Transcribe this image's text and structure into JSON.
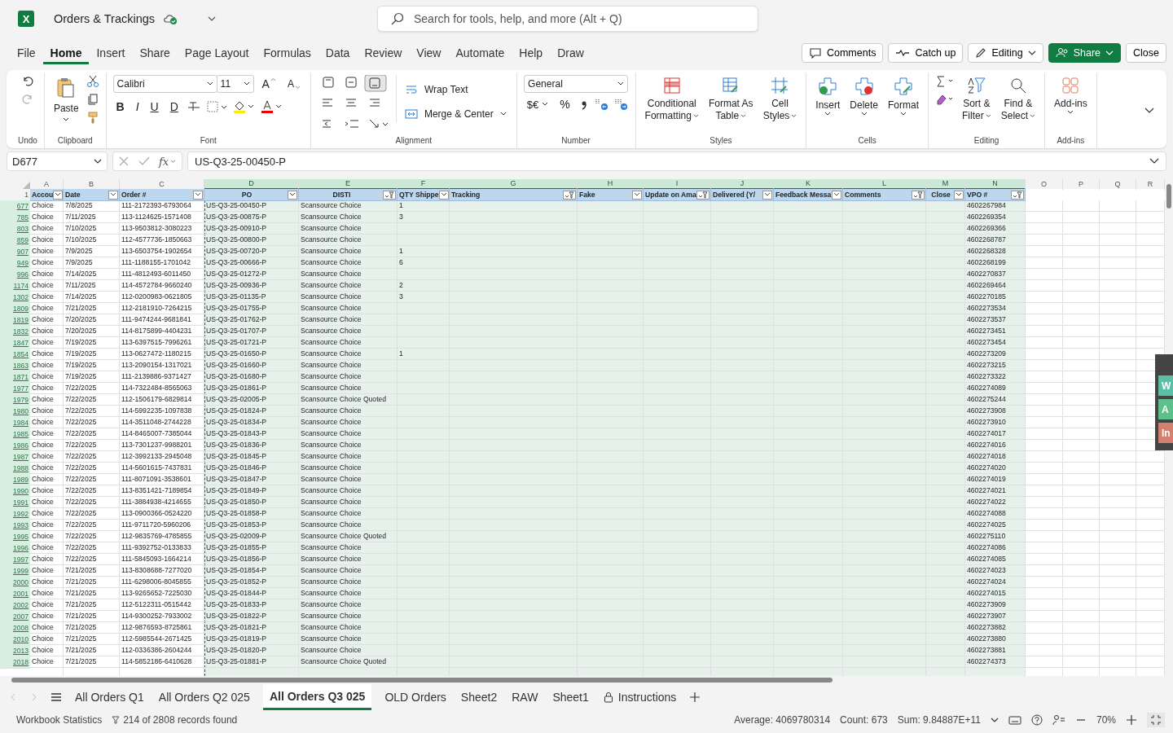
{
  "app": {
    "logo": "X",
    "title": "Orders & Trackings"
  },
  "search": {
    "placeholder": "Search for tools, help, and more (Alt + Q)"
  },
  "menu": [
    {
      "label": "File",
      "selected": false
    },
    {
      "label": "Home",
      "selected": true
    },
    {
      "label": "Insert",
      "selected": false
    },
    {
      "label": "Share",
      "selected": false
    },
    {
      "label": "Page Layout",
      "selected": false
    },
    {
      "label": "Formulas",
      "selected": false
    },
    {
      "label": "Data",
      "selected": false
    },
    {
      "label": "Review",
      "selected": false
    },
    {
      "label": "View",
      "selected": false
    },
    {
      "label": "Automate",
      "selected": false
    },
    {
      "label": "Help",
      "selected": false
    },
    {
      "label": "Draw",
      "selected": false
    }
  ],
  "actions": [
    {
      "label": "Comments",
      "kind": "comments"
    },
    {
      "label": "Catch up",
      "kind": "catchup"
    },
    {
      "label": "Editing",
      "kind": "editing"
    },
    {
      "label": "Share",
      "kind": "share"
    },
    {
      "label": "Close",
      "kind": "close"
    }
  ],
  "ribbon": {
    "undo": "Undo",
    "paste": "Paste",
    "clipboard": "Clipboard",
    "font_name": "Calibri",
    "font_size": "11",
    "grow": "A",
    "shrink": "A",
    "styles_letters": [
      "B",
      "I",
      "U",
      "D"
    ],
    "font": "Font",
    "wrap": "Wrap Text",
    "merge": "Merge & Center",
    "alignment": "Alignment",
    "number_format": "General",
    "currency": "$€",
    "percent": "%",
    "number": "Number",
    "styles": [
      [
        "Conditional",
        "Formatting"
      ],
      [
        "Format As",
        "Table"
      ],
      [
        "Cell",
        "Styles"
      ]
    ],
    "styles_group": "Styles",
    "cells": [
      "Insert",
      "Delete",
      "Format"
    ],
    "cells_group": "Cells",
    "editing": [
      [
        "Sort &",
        "Filter"
      ],
      [
        "Find &",
        "Select"
      ]
    ],
    "editing_group": "Editing",
    "addins": "Add-ins",
    "addins_group": "Add-ins"
  },
  "formula_bar": {
    "name_box": "D677",
    "fx": "fx",
    "value": "US-Q3-25-00450-P"
  },
  "columns": [
    {
      "letter": "A",
      "header": "Accou",
      "filtered": false,
      "selected": false
    },
    {
      "letter": "B",
      "header": "Date",
      "filtered": false,
      "selected": false
    },
    {
      "letter": "C",
      "header": "Order #",
      "filtered": false,
      "selected": false
    },
    {
      "letter": "D",
      "header": "PO",
      "filtered": false,
      "selected": true
    },
    {
      "letter": "E",
      "header": "DISTI",
      "filtered": true,
      "selected": true
    },
    {
      "letter": "F",
      "header": "QTY Shippe",
      "filtered": false,
      "selected": true
    },
    {
      "letter": "G",
      "header": "Tracking",
      "filtered": true,
      "selected": true
    },
    {
      "letter": "H",
      "header": "Fake",
      "filtered": false,
      "selected": true
    },
    {
      "letter": "I",
      "header": "Update on Ama",
      "filtered": true,
      "selected": true
    },
    {
      "letter": "J",
      "header": "Delivered (Y/",
      "filtered": false,
      "selected": true
    },
    {
      "letter": "K",
      "header": "Feedback Messa",
      "filtered": false,
      "selected": true
    },
    {
      "letter": "L",
      "header": "Comments",
      "filtered": true,
      "selected": true
    },
    {
      "letter": "M",
      "header": "Close",
      "filtered": false,
      "selected": true
    },
    {
      "letter": "N",
      "header": "VPO #",
      "filtered": true,
      "selected": true
    },
    {
      "letter": "O",
      "selected": false
    },
    {
      "letter": "P",
      "selected": false
    },
    {
      "letter": "Q",
      "selected": false
    },
    {
      "letter": "R",
      "selected": false
    }
  ],
  "header_row": "1",
  "rows": [
    {
      "row": "677",
      "A": "Choice",
      "B": "7/8/2025",
      "C": "111-2172393-6793064",
      "D": "US-Q3-25-00450-P",
      "E": "Scansource Choice",
      "F": "1",
      "N": "4602267984"
    },
    {
      "row": "785",
      "A": "Choice",
      "B": "7/11/2025",
      "C": "113-1124625-1571408",
      "D": "US-Q3-25-00875-P",
      "E": "Scansource Choice",
      "F": "3",
      "N": "4602269354"
    },
    {
      "row": "803",
      "A": "Choice",
      "B": "7/10/2025",
      "C": "113-9503812-3080223",
      "D": "US-Q3-25-00910-P",
      "E": "Scansource Choice",
      "N": "4602269366"
    },
    {
      "row": "859",
      "A": "Choice",
      "B": "7/10/2025",
      "C": "112-4577736-1850663",
      "D": "US-Q3-25-00800-P",
      "E": "Scansource Choice",
      "N": "4602268787"
    },
    {
      "row": "907",
      "A": "Choice",
      "B": "7/9/2025",
      "C": "113-6503754-1902654",
      "D": "US-Q3-25-00720-P",
      "E": "Scansource Choice",
      "F": "1",
      "N": "4602268328"
    },
    {
      "row": "949",
      "A": "Choice",
      "B": "7/9/2025",
      "C": "111-1188155-1701042",
      "D": "US-Q3-25-00666-P",
      "E": "Scansource Choice",
      "F": "6",
      "N": "4602268199"
    },
    {
      "row": "996",
      "A": "Choice",
      "B": "7/14/2025",
      "C": "111-4812493-6011450",
      "D": "US-Q3-25-01272-P",
      "E": "Scansource Choice",
      "N": "4602270837"
    },
    {
      "row": "1174",
      "A": "Choice",
      "B": "7/11/2025",
      "C": "114-4572784-9660240",
      "D": "US-Q3-25-00936-P",
      "E": "Scansource Choice",
      "F": "2",
      "N": "4602269464"
    },
    {
      "row": "1302",
      "A": "Choice",
      "B": "7/14/2025",
      "C": "112-0200983-0621805",
      "D": "US-Q3-25-01135-P",
      "E": "Scansource Choice",
      "F": "3",
      "N": "4602270185"
    },
    {
      "row": "1809",
      "A": "Choice",
      "B": "7/21/2025",
      "C": "112-2181910-7264215",
      "D": "US-Q3-25-01755-P",
      "E": "Scansource Choice",
      "N": "4602273534"
    },
    {
      "row": "1819",
      "A": "Choice",
      "B": "7/20/2025",
      "C": "111-9474244-9681841",
      "D": "US-Q3-25-01762-P",
      "E": "Scansource Choice",
      "N": "4602273537"
    },
    {
      "row": "1832",
      "A": "Choice",
      "B": "7/20/2025",
      "C": "114-8175899-4404231",
      "D": "US-Q3-25-01707-P",
      "E": "Scansource Choice",
      "N": "4602273451"
    },
    {
      "row": "1847",
      "A": "Choice",
      "B": "7/19/2025",
      "C": "113-6397515-7996261",
      "D": "US-Q3-25-01721-P",
      "E": "Scansource Choice",
      "N": "4602273454"
    },
    {
      "row": "1854",
      "A": "Choice",
      "B": "7/19/2025",
      "C": "113-0627472-1180215",
      "D": "US-Q3-25-01650-P",
      "E": "Scansource Choice",
      "F": "1",
      "N": "4602273209"
    },
    {
      "row": "1863",
      "A": "Choice",
      "B": "7/19/2025",
      "C": "113-2090154-1317021",
      "D": "US-Q3-25-01660-P",
      "E": "Scansource Choice",
      "N": "4602273215"
    },
    {
      "row": "1871",
      "A": "Choice",
      "B": "7/19/2025",
      "C": "111-2139886-9371427",
      "D": "US-Q3-25-01680-P",
      "E": "Scansource Choice",
      "N": "4602273322"
    },
    {
      "row": "1977",
      "A": "Choice",
      "B": "7/22/2025",
      "C": "114-7322484-8565063",
      "D": "US-Q3-25-01861-P",
      "E": "Scansource Choice",
      "N": "4602274089"
    },
    {
      "row": "1979",
      "A": "Choice",
      "B": "7/22/2025",
      "C": "112-1506179-6829814",
      "D": "US-Q3-25-02005-P",
      "E": "Scansource Choice Quoted",
      "N": "4602275244"
    },
    {
      "row": "1980",
      "A": "Choice",
      "B": "7/22/2025",
      "C": "114-5992235-1097838",
      "D": "US-Q3-25-01824-P",
      "E": "Scansource Choice",
      "N": "4602273908"
    },
    {
      "row": "1984",
      "A": "Choice",
      "B": "7/22/2025",
      "C": "114-3511048-2744228",
      "D": "US-Q3-25-01834-P",
      "E": "Scansource Choice",
      "N": "4602273910"
    },
    {
      "row": "1985",
      "A": "Choice",
      "B": "7/22/2025",
      "C": "114-8465007-7385044",
      "D": "US-Q3-25-01843-P",
      "E": "Scansource Choice",
      "N": "4602274017"
    },
    {
      "row": "1986",
      "A": "Choice",
      "B": "7/22/2025",
      "C": "113-7301237-9988201",
      "D": "US-Q3-25-01836-P",
      "E": "Scansource Choice",
      "N": "4602274016"
    },
    {
      "row": "1987",
      "A": "Choice",
      "B": "7/22/2025",
      "C": "112-3992133-2945048",
      "D": "US-Q3-25-01845-P",
      "E": "Scansource Choice",
      "N": "4602274018"
    },
    {
      "row": "1988",
      "A": "Choice",
      "B": "7/22/2025",
      "C": "114-5601615-7437831",
      "D": "US-Q3-25-01846-P",
      "E": "Scansource Choice",
      "N": "4602274020"
    },
    {
      "row": "1989",
      "A": "Choice",
      "B": "7/22/2025",
      "C": "111-8071091-3538601",
      "D": "US-Q3-25-01847-P",
      "E": "Scansource Choice",
      "N": "4602274019"
    },
    {
      "row": "1990",
      "A": "Choice",
      "B": "7/22/2025",
      "C": "113-8351421-7189854",
      "D": "US-Q3-25-01849-P",
      "E": "Scansource Choice",
      "N": "4602274021"
    },
    {
      "row": "1991",
      "A": "Choice",
      "B": "7/22/2025",
      "C": "111-3884938-4214655",
      "D": "US-Q3-25-01850-P",
      "E": "Scansource Choice",
      "N": "4602274022"
    },
    {
      "row": "1992",
      "A": "Choice",
      "B": "7/22/2025",
      "C": "113-0900366-0524220",
      "D": "US-Q3-25-01858-P",
      "E": "Scansource Choice",
      "N": "4602274088"
    },
    {
      "row": "1993",
      "A": "Choice",
      "B": "7/22/2025",
      "C": "111-9711720-5960206",
      "D": "US-Q3-25-01853-P",
      "E": "Scansource Choice",
      "N": "4602274025"
    },
    {
      "row": "1995",
      "A": "Choice",
      "B": "7/22/2025",
      "C": "112-9835769-4785855",
      "D": "US-Q3-25-02009-P",
      "E": "Scansource Choice Quoted",
      "N": "4602275110"
    },
    {
      "row": "1996",
      "A": "Choice",
      "B": "7/22/2025",
      "C": "111-9392752-0133833",
      "D": "US-Q3-25-01855-P",
      "E": "Scansource Choice",
      "N": "4602274086"
    },
    {
      "row": "1997",
      "A": "Choice",
      "B": "7/22/2025",
      "C": "111-5845093-1664214",
      "D": "US-Q3-25-01856-P",
      "E": "Scansource Choice",
      "N": "4602274085"
    },
    {
      "row": "1999",
      "A": "Choice",
      "B": "7/21/2025",
      "C": "113-8308688-7277020",
      "D": "US-Q3-25-01854-P",
      "E": "Scansource Choice",
      "N": "4602274023"
    },
    {
      "row": "2000",
      "A": "Choice",
      "B": "7/21/2025",
      "C": "111-6298006-8045855",
      "D": "US-Q3-25-01852-P",
      "E": "Scansource Choice",
      "N": "4602274024"
    },
    {
      "row": "2001",
      "A": "Choice",
      "B": "7/21/2025",
      "C": "113-9265652-7225030",
      "D": "US-Q3-25-01844-P",
      "E": "Scansource Choice",
      "N": "4602274015"
    },
    {
      "row": "2002",
      "A": "Choice",
      "B": "7/21/2025",
      "C": "112-5122311-0515442",
      "D": "US-Q3-25-01833-P",
      "E": "Scansource Choice",
      "N": "4602273909"
    },
    {
      "row": "2007",
      "A": "Choice",
      "B": "7/21/2025",
      "C": "114-9300252-7933002",
      "D": "US-Q3-25-01822-P",
      "E": "Scansource Choice",
      "N": "4602273907"
    },
    {
      "row": "2008",
      "A": "Choice",
      "B": "7/21/2025",
      "C": "112-9876593-8725861",
      "D": "US-Q3-25-01821-P",
      "E": "Scansource Choice",
      "N": "4602273882"
    },
    {
      "row": "2010",
      "A": "Choice",
      "B": "7/21/2025",
      "C": "112-5985544-2671425",
      "D": "US-Q3-25-01819-P",
      "E": "Scansource Choice",
      "N": "4602273880"
    },
    {
      "row": "2013",
      "A": "Choice",
      "B": "7/21/2025",
      "C": "112-0336386-2604244",
      "D": "US-Q3-25-01820-P",
      "E": "Scansource Choice",
      "N": "4602273881"
    },
    {
      "row": "2018",
      "A": "Choice",
      "B": "7/21/2025",
      "C": "114-5852186-6410628",
      "D": "US-Q3-25-01881-P",
      "E": "Scansource Choice Quoted",
      "N": "4602274373"
    }
  ],
  "side_panel": [
    {
      "label": "W",
      "color": "#5bbfa6"
    },
    {
      "label": "A",
      "color": "#5cbf8c"
    },
    {
      "label": "In",
      "color": "#d2806f"
    }
  ],
  "sheets": [
    {
      "label": "All Orders Q1",
      "selected": false,
      "kind": "plain"
    },
    {
      "label": "All Orders Q2 025",
      "selected": false,
      "kind": "plain"
    },
    {
      "label": "All Orders Q3 025",
      "selected": true,
      "kind": "plain"
    },
    {
      "label": "OLD Orders",
      "selected": false,
      "kind": "plain"
    },
    {
      "label": "Sheet2",
      "selected": false,
      "kind": "plain"
    },
    {
      "label": "RAW",
      "selected": false,
      "kind": "plain"
    },
    {
      "label": "Sheet1",
      "selected": false,
      "kind": "plain"
    },
    {
      "label": "Instructions",
      "selected": false,
      "kind": "locked"
    }
  ],
  "status_bar": {
    "stats": "Workbook Statistics",
    "records": "214 of 2808 records found",
    "average": "Average: 4069780314",
    "count": "Count: 673",
    "sum": "Sum: 9.84887E+11",
    "zoom": "70%"
  }
}
